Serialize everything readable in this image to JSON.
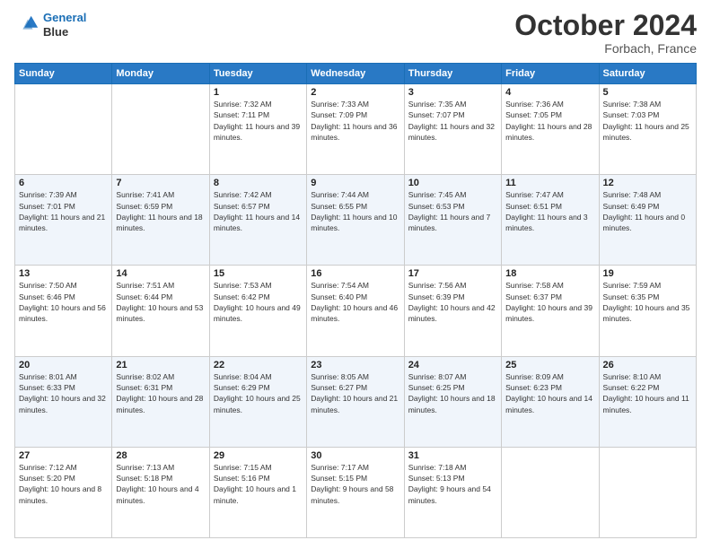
{
  "header": {
    "logo_line1": "General",
    "logo_line2": "Blue",
    "month": "October 2024",
    "location": "Forbach, France"
  },
  "weekdays": [
    "Sunday",
    "Monday",
    "Tuesday",
    "Wednesday",
    "Thursday",
    "Friday",
    "Saturday"
  ],
  "weeks": [
    [
      {
        "day": "",
        "content": ""
      },
      {
        "day": "",
        "content": ""
      },
      {
        "day": "1",
        "content": "Sunrise: 7:32 AM\nSunset: 7:11 PM\nDaylight: 11 hours and 39 minutes."
      },
      {
        "day": "2",
        "content": "Sunrise: 7:33 AM\nSunset: 7:09 PM\nDaylight: 11 hours and 36 minutes."
      },
      {
        "day": "3",
        "content": "Sunrise: 7:35 AM\nSunset: 7:07 PM\nDaylight: 11 hours and 32 minutes."
      },
      {
        "day": "4",
        "content": "Sunrise: 7:36 AM\nSunset: 7:05 PM\nDaylight: 11 hours and 28 minutes."
      },
      {
        "day": "5",
        "content": "Sunrise: 7:38 AM\nSunset: 7:03 PM\nDaylight: 11 hours and 25 minutes."
      }
    ],
    [
      {
        "day": "6",
        "content": "Sunrise: 7:39 AM\nSunset: 7:01 PM\nDaylight: 11 hours and 21 minutes."
      },
      {
        "day": "7",
        "content": "Sunrise: 7:41 AM\nSunset: 6:59 PM\nDaylight: 11 hours and 18 minutes."
      },
      {
        "day": "8",
        "content": "Sunrise: 7:42 AM\nSunset: 6:57 PM\nDaylight: 11 hours and 14 minutes."
      },
      {
        "day": "9",
        "content": "Sunrise: 7:44 AM\nSunset: 6:55 PM\nDaylight: 11 hours and 10 minutes."
      },
      {
        "day": "10",
        "content": "Sunrise: 7:45 AM\nSunset: 6:53 PM\nDaylight: 11 hours and 7 minutes."
      },
      {
        "day": "11",
        "content": "Sunrise: 7:47 AM\nSunset: 6:51 PM\nDaylight: 11 hours and 3 minutes."
      },
      {
        "day": "12",
        "content": "Sunrise: 7:48 AM\nSunset: 6:49 PM\nDaylight: 11 hours and 0 minutes."
      }
    ],
    [
      {
        "day": "13",
        "content": "Sunrise: 7:50 AM\nSunset: 6:46 PM\nDaylight: 10 hours and 56 minutes."
      },
      {
        "day": "14",
        "content": "Sunrise: 7:51 AM\nSunset: 6:44 PM\nDaylight: 10 hours and 53 minutes."
      },
      {
        "day": "15",
        "content": "Sunrise: 7:53 AM\nSunset: 6:42 PM\nDaylight: 10 hours and 49 minutes."
      },
      {
        "day": "16",
        "content": "Sunrise: 7:54 AM\nSunset: 6:40 PM\nDaylight: 10 hours and 46 minutes."
      },
      {
        "day": "17",
        "content": "Sunrise: 7:56 AM\nSunset: 6:39 PM\nDaylight: 10 hours and 42 minutes."
      },
      {
        "day": "18",
        "content": "Sunrise: 7:58 AM\nSunset: 6:37 PM\nDaylight: 10 hours and 39 minutes."
      },
      {
        "day": "19",
        "content": "Sunrise: 7:59 AM\nSunset: 6:35 PM\nDaylight: 10 hours and 35 minutes."
      }
    ],
    [
      {
        "day": "20",
        "content": "Sunrise: 8:01 AM\nSunset: 6:33 PM\nDaylight: 10 hours and 32 minutes."
      },
      {
        "day": "21",
        "content": "Sunrise: 8:02 AM\nSunset: 6:31 PM\nDaylight: 10 hours and 28 minutes."
      },
      {
        "day": "22",
        "content": "Sunrise: 8:04 AM\nSunset: 6:29 PM\nDaylight: 10 hours and 25 minutes."
      },
      {
        "day": "23",
        "content": "Sunrise: 8:05 AM\nSunset: 6:27 PM\nDaylight: 10 hours and 21 minutes."
      },
      {
        "day": "24",
        "content": "Sunrise: 8:07 AM\nSunset: 6:25 PM\nDaylight: 10 hours and 18 minutes."
      },
      {
        "day": "25",
        "content": "Sunrise: 8:09 AM\nSunset: 6:23 PM\nDaylight: 10 hours and 14 minutes."
      },
      {
        "day": "26",
        "content": "Sunrise: 8:10 AM\nSunset: 6:22 PM\nDaylight: 10 hours and 11 minutes."
      }
    ],
    [
      {
        "day": "27",
        "content": "Sunrise: 7:12 AM\nSunset: 5:20 PM\nDaylight: 10 hours and 8 minutes."
      },
      {
        "day": "28",
        "content": "Sunrise: 7:13 AM\nSunset: 5:18 PM\nDaylight: 10 hours and 4 minutes."
      },
      {
        "day": "29",
        "content": "Sunrise: 7:15 AM\nSunset: 5:16 PM\nDaylight: 10 hours and 1 minute."
      },
      {
        "day": "30",
        "content": "Sunrise: 7:17 AM\nSunset: 5:15 PM\nDaylight: 9 hours and 58 minutes."
      },
      {
        "day": "31",
        "content": "Sunrise: 7:18 AM\nSunset: 5:13 PM\nDaylight: 9 hours and 54 minutes."
      },
      {
        "day": "",
        "content": ""
      },
      {
        "day": "",
        "content": ""
      }
    ]
  ]
}
